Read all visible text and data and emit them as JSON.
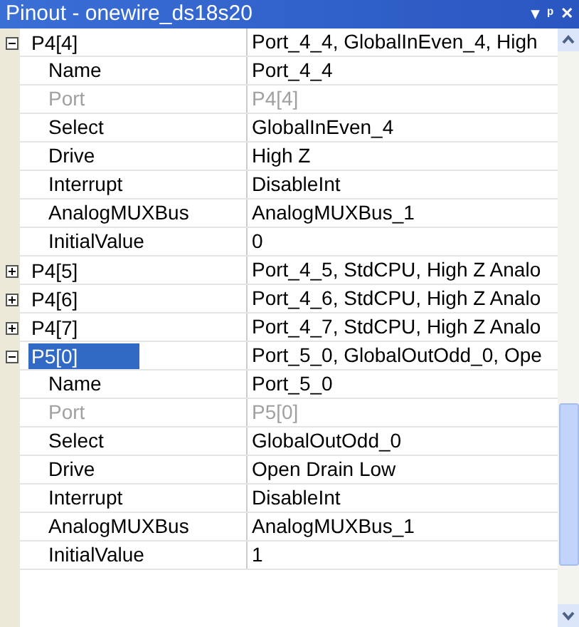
{
  "window": {
    "title": "Pinout - onewire_ds18s20",
    "buttons": [
      "▾",
      "ᵖ",
      "✕"
    ]
  },
  "groups": [
    {
      "name": "P4[4]",
      "value": "Port_4_4, GlobalInEven_4, High",
      "expanded": true,
      "selected": false,
      "children": [
        {
          "name": "Name",
          "value": "Port_4_4",
          "disabled": false
        },
        {
          "name": "Port",
          "value": "P4[4]",
          "disabled": true
        },
        {
          "name": "Select",
          "value": "GlobalInEven_4",
          "disabled": false
        },
        {
          "name": "Drive",
          "value": "High Z",
          "disabled": false
        },
        {
          "name": "Interrupt",
          "value": "DisableInt",
          "disabled": false
        },
        {
          "name": "AnalogMUXBus",
          "value": "AnalogMUXBus_1",
          "disabled": false
        },
        {
          "name": "InitialValue",
          "value": "0",
          "disabled": false
        }
      ]
    },
    {
      "name": "P4[5]",
      "value": "Port_4_5, StdCPU, High Z Analo",
      "expanded": false,
      "selected": false
    },
    {
      "name": "P4[6]",
      "value": "Port_4_6, StdCPU, High Z Analo",
      "expanded": false,
      "selected": false
    },
    {
      "name": "P4[7]",
      "value": "Port_4_7, StdCPU, High Z Analo",
      "expanded": false,
      "selected": false
    },
    {
      "name": "P5[0]",
      "value": "Port_5_0, GlobalOutOdd_0, Ope",
      "expanded": true,
      "selected": true,
      "children": [
        {
          "name": "Name",
          "value": "Port_5_0",
          "disabled": false
        },
        {
          "name": "Port",
          "value": "P5[0]",
          "disabled": true
        },
        {
          "name": "Select",
          "value": "GlobalOutOdd_0",
          "disabled": false
        },
        {
          "name": "Drive",
          "value": "Open Drain Low",
          "disabled": false
        },
        {
          "name": "Interrupt",
          "value": "DisableInt",
          "disabled": false
        },
        {
          "name": "AnalogMUXBus",
          "value": "AnalogMUXBus_1",
          "disabled": false
        },
        {
          "name": "InitialValue",
          "value": "1",
          "disabled": false
        }
      ]
    }
  ]
}
